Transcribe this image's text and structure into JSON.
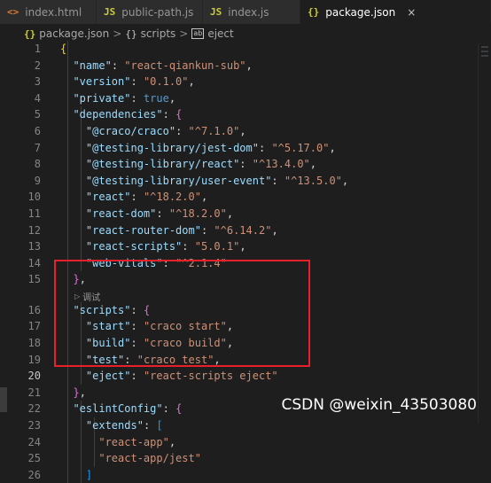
{
  "tabs": [
    {
      "label": "index.html",
      "icon": "<>",
      "kind": "html"
    },
    {
      "label": "public-path.js",
      "icon": "JS",
      "kind": "js"
    },
    {
      "label": "index.js",
      "icon": "JS",
      "kind": "js"
    },
    {
      "label": "package.json",
      "icon": "{}",
      "kind": "json",
      "active": true,
      "close": "×"
    }
  ],
  "breadcrumb": {
    "file_icon": "{}",
    "file": "package.json",
    "sep": ">",
    "sym1_icon": "{}",
    "sym1": "scripts",
    "sym2_icon": "ab",
    "sym2": "eject"
  },
  "codelens": {
    "label": "调试",
    "icon": "play-icon"
  },
  "current_line": 20,
  "lines": [
    {
      "n": "1",
      "tokens": [
        [
          "b1",
          "{"
        ]
      ]
    },
    {
      "n": "2",
      "tokens": [
        [
          "p",
          "  "
        ],
        [
          "k",
          "\"name\""
        ],
        [
          "p",
          ": "
        ],
        [
          "s",
          "\"react-qiankun-sub\""
        ],
        [
          "p",
          ","
        ]
      ]
    },
    {
      "n": "3",
      "tokens": [
        [
          "p",
          "  "
        ],
        [
          "k",
          "\"version\""
        ],
        [
          "p",
          ": "
        ],
        [
          "s",
          "\"0.1.0\""
        ],
        [
          "p",
          ","
        ]
      ]
    },
    {
      "n": "4",
      "tokens": [
        [
          "p",
          "  "
        ],
        [
          "k",
          "\"private\""
        ],
        [
          "p",
          ": "
        ],
        [
          "kw",
          "true"
        ],
        [
          "p",
          ","
        ]
      ]
    },
    {
      "n": "5",
      "tokens": [
        [
          "p",
          "  "
        ],
        [
          "k",
          "\"dependencies\""
        ],
        [
          "p",
          ": "
        ],
        [
          "b2",
          "{"
        ]
      ]
    },
    {
      "n": "6",
      "tokens": [
        [
          "p",
          "    "
        ],
        [
          "k",
          "\"@craco/craco\""
        ],
        [
          "p",
          ": "
        ],
        [
          "s",
          "\"^7.1.0\""
        ],
        [
          "p",
          ","
        ]
      ]
    },
    {
      "n": "7",
      "tokens": [
        [
          "p",
          "    "
        ],
        [
          "k",
          "\"@testing-library/jest-dom\""
        ],
        [
          "p",
          ": "
        ],
        [
          "s",
          "\"^5.17.0\""
        ],
        [
          "p",
          ","
        ]
      ]
    },
    {
      "n": "8",
      "tokens": [
        [
          "p",
          "    "
        ],
        [
          "k",
          "\"@testing-library/react\""
        ],
        [
          "p",
          ": "
        ],
        [
          "s",
          "\"^13.4.0\""
        ],
        [
          "p",
          ","
        ]
      ]
    },
    {
      "n": "9",
      "tokens": [
        [
          "p",
          "    "
        ],
        [
          "k",
          "\"@testing-library/user-event\""
        ],
        [
          "p",
          ": "
        ],
        [
          "s",
          "\"^13.5.0\""
        ],
        [
          "p",
          ","
        ]
      ]
    },
    {
      "n": "10",
      "tokens": [
        [
          "p",
          "    "
        ],
        [
          "k",
          "\"react\""
        ],
        [
          "p",
          ": "
        ],
        [
          "s",
          "\"^18.2.0\""
        ],
        [
          "p",
          ","
        ]
      ]
    },
    {
      "n": "11",
      "tokens": [
        [
          "p",
          "    "
        ],
        [
          "k",
          "\"react-dom\""
        ],
        [
          "p",
          ": "
        ],
        [
          "s",
          "\"^18.2.0\""
        ],
        [
          "p",
          ","
        ]
      ]
    },
    {
      "n": "12",
      "tokens": [
        [
          "p",
          "    "
        ],
        [
          "k",
          "\"react-router-dom\""
        ],
        [
          "p",
          ": "
        ],
        [
          "s",
          "\"^6.14.2\""
        ],
        [
          "p",
          ","
        ]
      ]
    },
    {
      "n": "13",
      "tokens": [
        [
          "p",
          "    "
        ],
        [
          "k",
          "\"react-scripts\""
        ],
        [
          "p",
          ": "
        ],
        [
          "s",
          "\"5.0.1\""
        ],
        [
          "p",
          ","
        ]
      ]
    },
    {
      "n": "14",
      "tokens": [
        [
          "p",
          "    "
        ],
        [
          "k",
          "\"web-vitals\""
        ],
        [
          "p",
          ": "
        ],
        [
          "s",
          "\"^2.1.4\""
        ]
      ]
    },
    {
      "n": "15",
      "tokens": [
        [
          "p",
          "  "
        ],
        [
          "b2",
          "}"
        ],
        [
          "p",
          ","
        ]
      ]
    },
    {
      "n": "16",
      "tokens": [
        [
          "p",
          "  "
        ],
        [
          "k",
          "\"scripts\""
        ],
        [
          "p",
          ": "
        ],
        [
          "b2",
          "{"
        ]
      ]
    },
    {
      "n": "17",
      "tokens": [
        [
          "p",
          "    "
        ],
        [
          "k",
          "\"start\""
        ],
        [
          "p",
          ": "
        ],
        [
          "s",
          "\"craco start\""
        ],
        [
          "p",
          ","
        ]
      ]
    },
    {
      "n": "18",
      "tokens": [
        [
          "p",
          "    "
        ],
        [
          "k",
          "\"build\""
        ],
        [
          "p",
          ": "
        ],
        [
          "s",
          "\"craco build\""
        ],
        [
          "p",
          ","
        ]
      ]
    },
    {
      "n": "19",
      "tokens": [
        [
          "p",
          "    "
        ],
        [
          "k",
          "\"test\""
        ],
        [
          "p",
          ": "
        ],
        [
          "s",
          "\"craco test\""
        ],
        [
          "p",
          ","
        ]
      ]
    },
    {
      "n": "20",
      "tokens": [
        [
          "p",
          "    "
        ],
        [
          "k",
          "\"eject\""
        ],
        [
          "p",
          ": "
        ],
        [
          "s",
          "\"react-scripts eject\""
        ]
      ]
    },
    {
      "n": "21",
      "tokens": [
        [
          "p",
          "  "
        ],
        [
          "b2",
          "}"
        ],
        [
          "p",
          ","
        ]
      ]
    },
    {
      "n": "22",
      "tokens": [
        [
          "p",
          "  "
        ],
        [
          "k",
          "\"eslintConfig\""
        ],
        [
          "p",
          ": "
        ],
        [
          "b2",
          "{"
        ]
      ]
    },
    {
      "n": "23",
      "tokens": [
        [
          "p",
          "    "
        ],
        [
          "k",
          "\"extends\""
        ],
        [
          "p",
          ": "
        ],
        [
          "b3",
          "["
        ]
      ]
    },
    {
      "n": "24",
      "tokens": [
        [
          "p",
          "      "
        ],
        [
          "s",
          "\"react-app\""
        ],
        [
          "p",
          ","
        ]
      ]
    },
    {
      "n": "25",
      "tokens": [
        [
          "p",
          "      "
        ],
        [
          "s",
          "\"react-app/jest\""
        ]
      ]
    },
    {
      "n": "26",
      "tokens": [
        [
          "p",
          "    "
        ],
        [
          "b3",
          "]"
        ]
      ]
    }
  ],
  "watermark": "CSDN @weixin_43503080",
  "colors": {
    "background": "#1e1e1e",
    "key": "#9cdcfe",
    "string": "#ce9178",
    "keyword": "#569cd6",
    "highlight_box": "#e8202a"
  }
}
